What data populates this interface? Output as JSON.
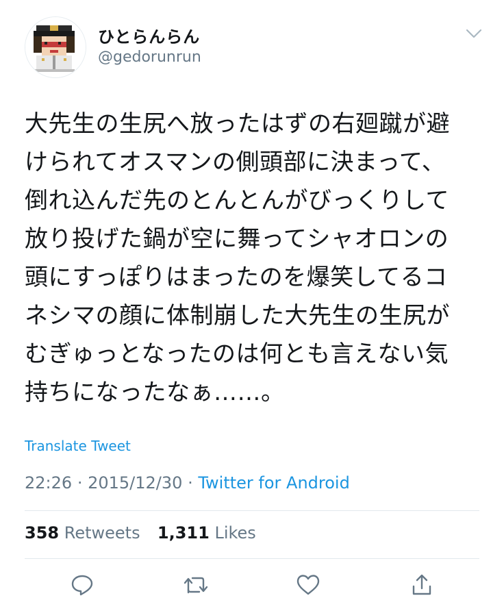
{
  "user": {
    "display_name": "ひとらんらん",
    "handle": "@gedorunrun"
  },
  "tweet": {
    "lines": [
      "大先生の生尻へ放ったはずの右廻蹴が避",
      "けられてオスマンの側頭部に決まって、",
      "倒れ込んだ先のとんとんがびっくりして",
      "放り投げた鍋が空に舞ってシャオロンの",
      "頭にすっぽりはまったのを爆笑してるコ",
      "ネシマの顔に体制崩した大先生の生尻が",
      "むぎゅっとなったのは何とも言えない気",
      "持ちになったなぁ……。"
    ],
    "translate_label": "Translate Tweet",
    "time": "22:26",
    "date": "2015/12/30",
    "separator": "·",
    "source": "Twitter for Android"
  },
  "stats": {
    "retweets_count": "358",
    "retweets_label": "Retweets",
    "likes_count": "1,311",
    "likes_label": "Likes"
  },
  "icons": {
    "caret": "chevron-down-icon",
    "reply": "reply-icon",
    "retweet": "retweet-icon",
    "like": "heart-icon",
    "share": "share-icon"
  },
  "colors": {
    "text": "#14171a",
    "secondary": "#657786",
    "link": "#1b95e0",
    "divider": "#e1e8ed"
  }
}
